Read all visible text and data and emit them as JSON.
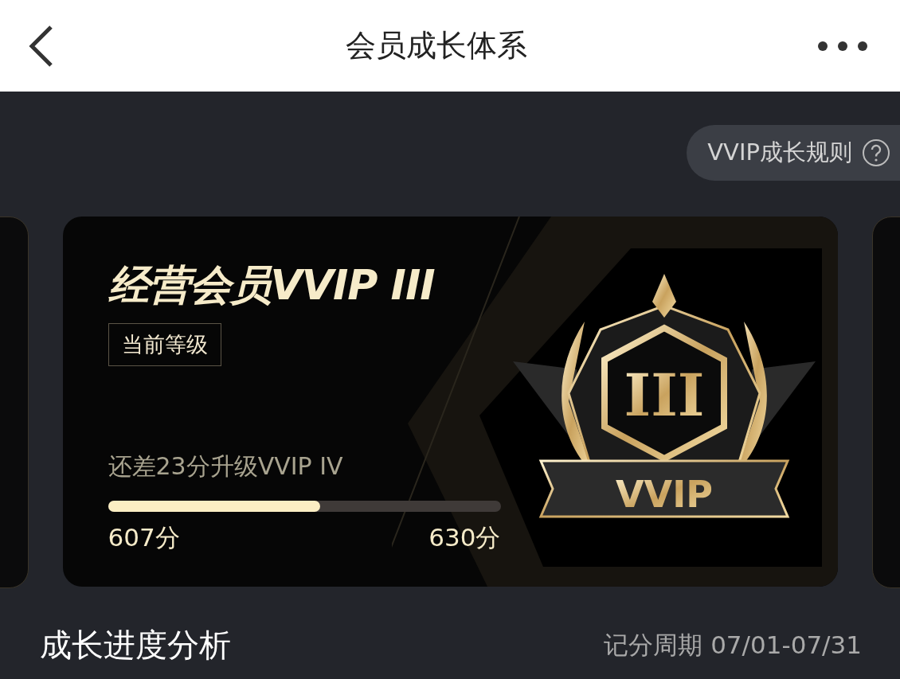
{
  "header": {
    "title": "会员成长体系"
  },
  "rules_button": {
    "label": "VVIP成长规则"
  },
  "card": {
    "title": "经营会员VVIP III",
    "tag": "当前等级",
    "hint": "还差23分升级VVIP IV",
    "level": 0.54,
    "current": "607分",
    "target": "630分",
    "badge": {
      "numeral": "III",
      "label": "VVIP"
    }
  },
  "section": {
    "title": "成长进度分析",
    "period": "记分周期 07/01-07/31"
  }
}
